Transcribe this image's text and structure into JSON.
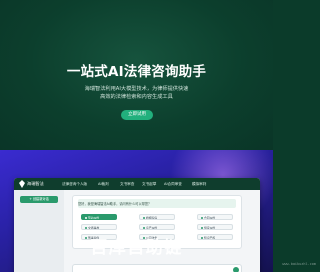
{
  "hero": {
    "title": "一站式AI法律咨询助手",
    "subtitle_line1": "海瑞智法利用AI大模型技术，为律师提供快速",
    "subtitle_line2": "高效的法律检索和内容生成工具",
    "cta_label": "立即试用"
  },
  "app": {
    "name": "海瑞智法",
    "nav_tabs": [
      "法律咨询个人版",
      "AI裁判",
      "文书审查",
      "文书起草",
      "AI合同审查",
      "模拟审判"
    ],
    "sidebar": {
      "new_chat_label": "+ 创建新对话"
    },
    "intro": {
      "text": "您好，我是海瑞智法AI助手，请问有什么可以帮您？"
    },
    "chips": [
      {
        "label": "劳动纠纷",
        "active": true
      },
      {
        "label": "婚姻家庭",
        "active": false
      },
      {
        "label": "合同纠纷",
        "active": false
      },
      {
        "label": "交通事故",
        "active": false
      },
      {
        "label": "房产纠纷",
        "active": false
      },
      {
        "label": "借贷纠纷",
        "active": false
      },
      {
        "label": "刑事案件",
        "active": false
      },
      {
        "label": "公司法务",
        "active": false
      },
      {
        "label": "知识产权",
        "active": false
      }
    ]
  },
  "watermark": {
    "text": "百库自助链",
    "url": "www.baikuzhl.com"
  },
  "colors": {
    "hero_bg": "#0c3f2d",
    "accent": "#22b07d",
    "lower_bg": "#2a22a8"
  }
}
